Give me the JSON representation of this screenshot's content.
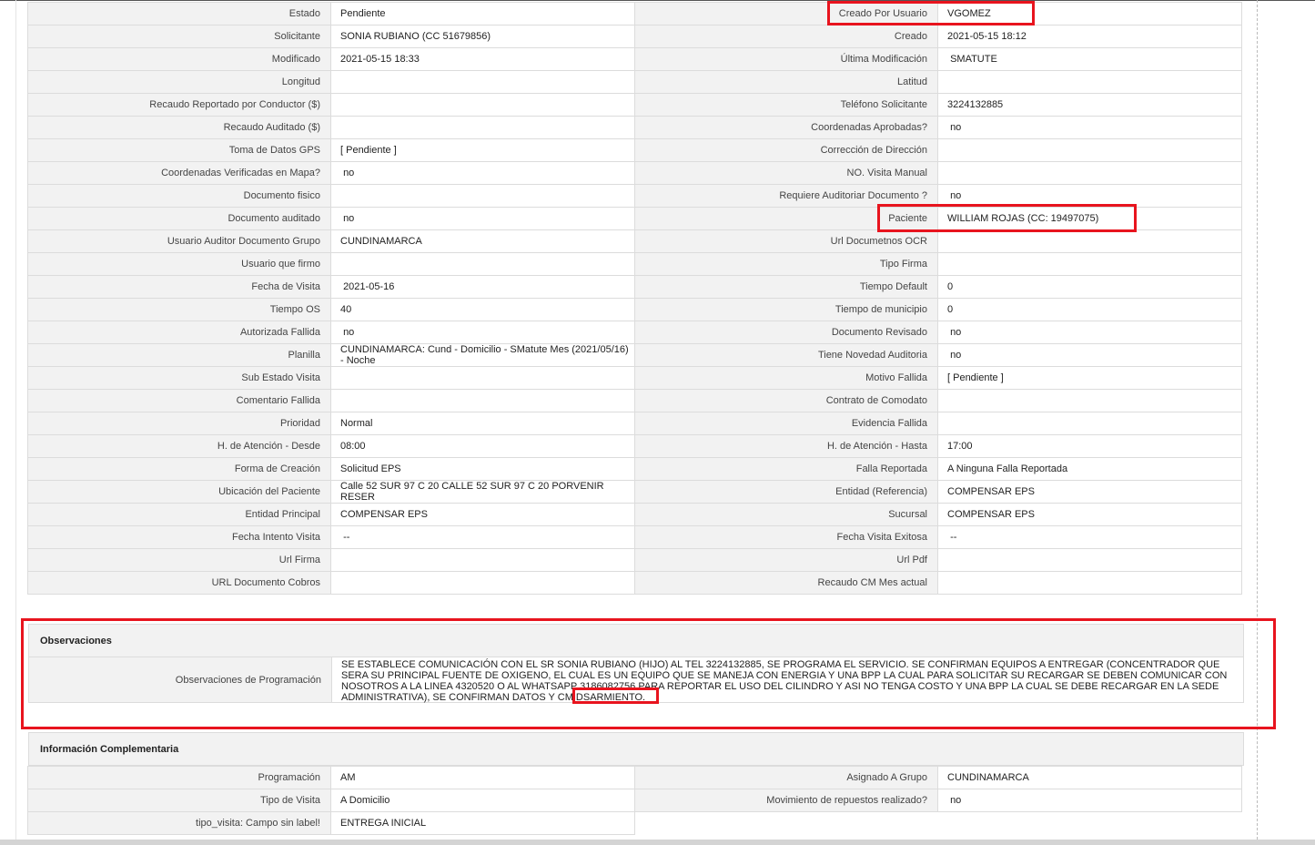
{
  "main_fields": [
    {
      "l1": "Estado",
      "v1": "Pendiente",
      "l2": "Creado Por Usuario",
      "v2": "VGOMEZ"
    },
    {
      "l1": "Solicitante",
      "v1": "SONIA RUBIANO (CC 51679856)",
      "l2": "Creado",
      "v2": "2021-05-15 18:12"
    },
    {
      "l1": "Modificado",
      "v1": "2021-05-15 18:33",
      "l2": "Última Modificación",
      "v2": " SMATUTE"
    },
    {
      "l1": "Longitud",
      "v1": "",
      "l2": "Latitud",
      "v2": ""
    },
    {
      "l1": "Recaudo Reportado por Conductor ($)",
      "v1": "",
      "l2": "Teléfono Solicitante",
      "v2": "3224132885"
    },
    {
      "l1": "Recaudo Auditado ($)",
      "v1": "",
      "l2": "Coordenadas Aprobadas?",
      "v2": " no"
    },
    {
      "l1": "Toma de Datos GPS",
      "v1": "[ Pendiente ]",
      "l2": "Corrección de Dirección",
      "v2": ""
    },
    {
      "l1": "Coordenadas Verificadas en Mapa?",
      "v1": " no",
      "l2": "NO. Visita Manual",
      "v2": ""
    },
    {
      "l1": "Documento fisico",
      "v1": "",
      "l2": "Requiere Auditoriar Documento ?",
      "v2": " no"
    },
    {
      "l1": "Documento auditado",
      "v1": " no",
      "l2": "Paciente",
      "v2": "WILLIAM ROJAS (CC: 19497075)"
    },
    {
      "l1": "Usuario Auditor Documento Grupo",
      "v1": "CUNDINAMARCA",
      "l2": "Url Documetnos OCR",
      "v2": ""
    },
    {
      "l1": "Usuario que firmo",
      "v1": "",
      "l2": "Tipo Firma",
      "v2": ""
    },
    {
      "l1": "Fecha de Visita",
      "v1": " 2021-05-16",
      "l2": "Tiempo Default",
      "v2": "0"
    },
    {
      "l1": "Tiempo OS",
      "v1": "40",
      "l2": "Tiempo de municipio",
      "v2": "0"
    },
    {
      "l1": "Autorizada Fallida",
      "v1": " no",
      "l2": "Documento Revisado",
      "v2": " no"
    },
    {
      "l1": "Planilla",
      "v1": "CUNDINAMARCA: Cund - Domicilio - SMatute Mes (2021/05/16) - Noche",
      "l2": "Tiene Novedad Auditoria",
      "v2": " no"
    },
    {
      "l1": "Sub Estado Visita",
      "v1": "",
      "l2": "Motivo Fallida",
      "v2": "[ Pendiente ]"
    },
    {
      "l1": "Comentario Fallida",
      "v1": "",
      "l2": "Contrato de Comodato",
      "v2": ""
    },
    {
      "l1": "Prioridad",
      "v1": "Normal",
      "l2": "Evidencia Fallida",
      "v2": ""
    },
    {
      "l1": "H. de Atención - Desde",
      "v1": "08:00",
      "l2": "H. de Atención - Hasta",
      "v2": "17:00"
    },
    {
      "l1": "Forma de Creación",
      "v1": "Solicitud EPS",
      "l2": "Falla Reportada",
      "v2": "A Ninguna Falla Reportada"
    },
    {
      "l1": "Ubicación del Paciente",
      "v1": "Calle 52 SUR 97 C 20 CALLE 52 SUR 97 C 20 PORVENIR RESER",
      "l2": "Entidad (Referencia)",
      "v2": "COMPENSAR EPS"
    },
    {
      "l1": "Entidad Principal",
      "v1": "COMPENSAR EPS",
      "l2": "Sucursal",
      "v2": "COMPENSAR EPS"
    },
    {
      "l1": "Fecha Intento Visita",
      "v1": " --",
      "l2": "Fecha Visita Exitosa",
      "v2": " --"
    },
    {
      "l1": "Url Firma",
      "v1": "",
      "l2": "Url Pdf",
      "v2": ""
    },
    {
      "l1": "URL Documento Cobros",
      "v1": "",
      "l2": "Recaudo CM Mes actual",
      "v2": ""
    }
  ],
  "observaciones": {
    "title": "Observaciones",
    "label": "Observaciones de Programación",
    "text": "  SE ESTABLECE COMUNICACIÓN CON EL SR SONIA RUBIANO (HIJO) AL TEL 3224132885, SE PROGRAMA EL SERVICIO. SE CONFIRMAN EQUIPOS A ENTREGAR (CONCENTRADOR QUE SERA SU PRINCIPAL FUENTE DE OXIGENO, EL CUAL ES UN EQUIPO QUE SE MANEJA CON ENERGIA Y UNA BPP LA CUAL PARA SOLICITAR SU RECARGAR SE DEBEN COMUNICAR CON NOSOTROS A LA LINEA 4320520 O AL WHATSAPP 3186082756 PARA REPORTAR EL USO DEL CILINDRO Y ASI NO TENGA COSTO Y UNA BPP LA CUAL SE DEBE RECARGAR EN LA SEDE ADMINISTRATIVA), SE CONFIRMAN DATOS Y CM DSARMIENTO."
  },
  "complementaria": {
    "title": "Información Complementaria",
    "rows": [
      {
        "l1": "Programación",
        "v1": "AM",
        "l2": "Asignado A Grupo",
        "v2": "CUNDINAMARCA"
      },
      {
        "l1": "Tipo de Visita",
        "v1": "A Domicilio",
        "l2": "Movimiento de repuestos realizado?",
        "v2": " no"
      },
      {
        "l1": "tipo_visita: Campo sin label!",
        "v1": "ENTREGA INICIAL",
        "l2": "",
        "v2": ""
      }
    ]
  },
  "highlight_color": "#e8141e"
}
